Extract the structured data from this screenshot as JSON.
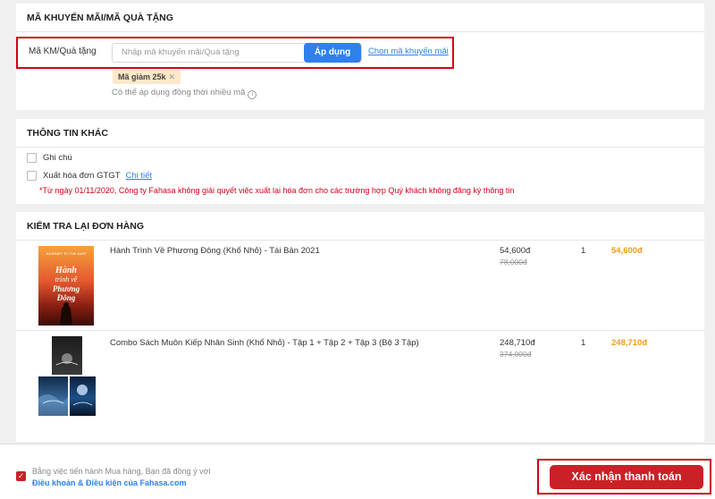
{
  "promo": {
    "title": "MÃ KHUYẾN MÃI/MÃ QUÀ TẶNG",
    "label": "Mã KM/Quà tặng",
    "placeholder": "Nhập mã khuyến mãi/Quà tặng",
    "apply_label": "Áp dụng",
    "choose_link": "Chọn mã khuyến mãi",
    "coupon_tag": "Mã giảm 25k",
    "multi_note": "Có thể áp dụng đồng thời nhiều mã"
  },
  "other": {
    "title": "THÔNG TIN KHÁC",
    "note_label": "Ghi chú",
    "invoice_label": "Xuất hóa đơn GTGT",
    "detail_link": "Chi tiết",
    "notice": "*Từ ngày 01/11/2020, Công ty Fahasa không giải quyết việc xuất lại hóa đơn cho các trường hợp Quý khách không đăng ký thông tin"
  },
  "review": {
    "title": "KIỂM TRA LẠI ĐƠN HÀNG",
    "items": [
      {
        "name": "Hành Trình Về Phương Đông (Khổ Nhỏ) - Tái Bản 2021",
        "price": "54,600đ",
        "old_price": "78,000đ",
        "qty": "1",
        "total": "54,600đ",
        "cover_text": "Hành trình về Phương Đông"
      },
      {
        "name": "Combo Sách Muôn Kiếp Nhân Sinh (Khổ Nhỏ) - Tập 1 + Tập 2 + Tập 3 (Bộ 3 Tập)",
        "price": "248,710đ",
        "old_price": "374,000đ",
        "qty": "1",
        "total": "248,710đ"
      }
    ]
  },
  "footer": {
    "agree_text": "Bằng việc tiến hành Mua hàng, Bạn đã đồng ý với",
    "terms_link": "Điều khoản & Điều kiện của Fahasa.com",
    "confirm_label": "Xác nhận thanh toán"
  },
  "colors": {
    "brand_red": "#c92127",
    "highlight_border": "#d0021b",
    "link_blue": "#2f80ed",
    "price_orange": "#f39c12"
  }
}
